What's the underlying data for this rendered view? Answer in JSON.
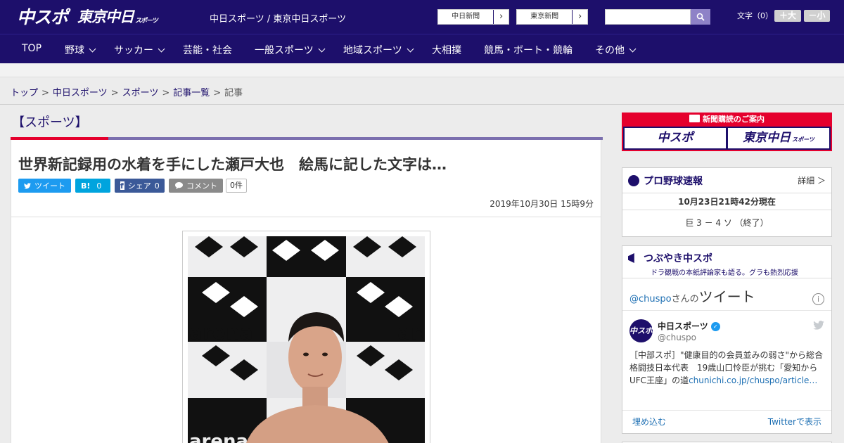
{
  "header": {
    "logo_chuspo": "中スポ",
    "logo_tokyo": "東京中日",
    "logo_tokyo_sub": "スポーツ",
    "site_names": "中日スポーツ / 東京中日スポーツ",
    "btn_chunichi": "中日新聞",
    "btn_tokyo": "東京新聞",
    "search_placeholder": "",
    "font_size_label": "文字（0）",
    "font_plus": "＋大",
    "font_minus": "－小"
  },
  "nav": {
    "items": [
      {
        "label": "TOP"
      },
      {
        "label": "野球"
      },
      {
        "label": "サッカー"
      },
      {
        "label": "芸能・社会"
      },
      {
        "label": "一般スポーツ"
      },
      {
        "label": "地域スポーツ"
      },
      {
        "label": "大相撲"
      },
      {
        "label": "競馬・ボート・競輪"
      },
      {
        "label": "その他"
      }
    ]
  },
  "breadcrumb": {
    "items": [
      "トップ",
      "中日スポーツ",
      "スポーツ",
      "記事一覧",
      "記事"
    ],
    "separator": ">"
  },
  "article": {
    "section": "【スポーツ】",
    "headline": "世界新記録用の水着を手にした瀬戸大也　絵馬に記した文字は…",
    "share": {
      "tweet": "ツイート",
      "hatena": "B!",
      "hatena_count": "0",
      "facebook": "シェア",
      "facebook_count": "0",
      "comment": "コメント",
      "comment_count": "0件"
    },
    "date": "2019年10月30日 15時9分",
    "photo_text": "arena"
  },
  "sidebar": {
    "subscribe": {
      "title": "新聞購読のご案内",
      "btn1": "中スポ",
      "btn2": "東京中日",
      "btn2_sub": "スポーツ"
    },
    "baseball": {
      "title": "プロ野球速報",
      "more": "詳細 ＞",
      "time": "10月23日21時42分現在",
      "score": "巨 3 － 4 ソ （終了）"
    },
    "tweets": {
      "title": "つぶやき中スポ",
      "subtitle": "ドラ観戦の本紙評論家も語る。グラも熱烈応援",
      "embed_handle_link": "@chuspo",
      "embed_handle_suffix": "さんの",
      "embed_title": "ツイート",
      "info": "i",
      "account_name": "中日スポーツ",
      "account_handle": "@chuspo",
      "avatar": "中スポ",
      "tweet_text": "［中部スポ］\"健康目的の会員並みの弱さ\"から総合格闘技日本代表　19歳山口怜臣が挑む「愛知からUFC王座」の道",
      "tweet_link": "chunichi.co.jp/chuspo/article…",
      "embed_link": "埋め込む",
      "view_on_twitter": "Twitterで表示"
    }
  },
  "colors": {
    "brand_navy": "#1d0f6b",
    "accent_red": "#e5002d",
    "twitter_blue": "#1d9bf0",
    "facebook_blue": "#3b5998"
  }
}
